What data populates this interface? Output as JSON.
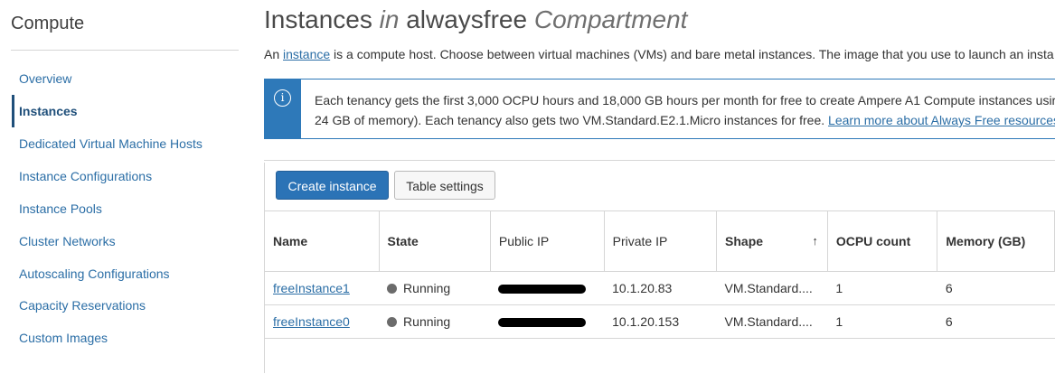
{
  "sidebar": {
    "title": "Compute",
    "items": [
      {
        "label": "Overview",
        "active": false
      },
      {
        "label": "Instances",
        "active": true
      },
      {
        "label": "Dedicated Virtual Machine Hosts",
        "active": false
      },
      {
        "label": "Instance Configurations",
        "active": false
      },
      {
        "label": "Instance Pools",
        "active": false
      },
      {
        "label": "Cluster Networks",
        "active": false
      },
      {
        "label": "Autoscaling Configurations",
        "active": false
      },
      {
        "label": "Capacity Reservations",
        "active": false
      },
      {
        "label": "Custom Images",
        "active": false
      }
    ]
  },
  "header": {
    "title_main": "Instances",
    "title_in": "in",
    "compartment": "alwaysfree",
    "title_suffix": "Compartment"
  },
  "intro": {
    "prefix": "An ",
    "link": "instance",
    "text": " is a compute host. Choose between virtual machines (VMs) and bare metal instances. The image that you use to launch an insta"
  },
  "banner": {
    "icon": "info-icon",
    "line1": "Each tenancy gets the first 3,000 OCPU hours and 18,000 GB hours per month for free to create Ampere A1 Compute instances usir",
    "line2": "24 GB of memory). Each tenancy also gets two VM.Standard.E2.1.Micro instances for free. ",
    "link": "Learn more about Always Free resources",
    "accent": "#2e79b9"
  },
  "toolbar": {
    "create_label": "Create instance",
    "settings_label": "Table settings"
  },
  "table": {
    "columns": [
      "Name",
      "State",
      "Public IP",
      "Private IP",
      "Shape",
      "OCPU count",
      "Memory (GB)"
    ],
    "sort_icon": "arrow-up-icon",
    "sort_glyph": "↑",
    "rows": [
      {
        "name": "freeInstance1",
        "state": "Running",
        "private_ip": "10.1.20.83",
        "shape": "VM.Standard....",
        "ocpu": "1",
        "memory": "6"
      },
      {
        "name": "freeInstance0",
        "state": "Running",
        "private_ip": "10.1.20.153",
        "shape": "VM.Standard....",
        "ocpu": "1",
        "memory": "6"
      }
    ]
  }
}
